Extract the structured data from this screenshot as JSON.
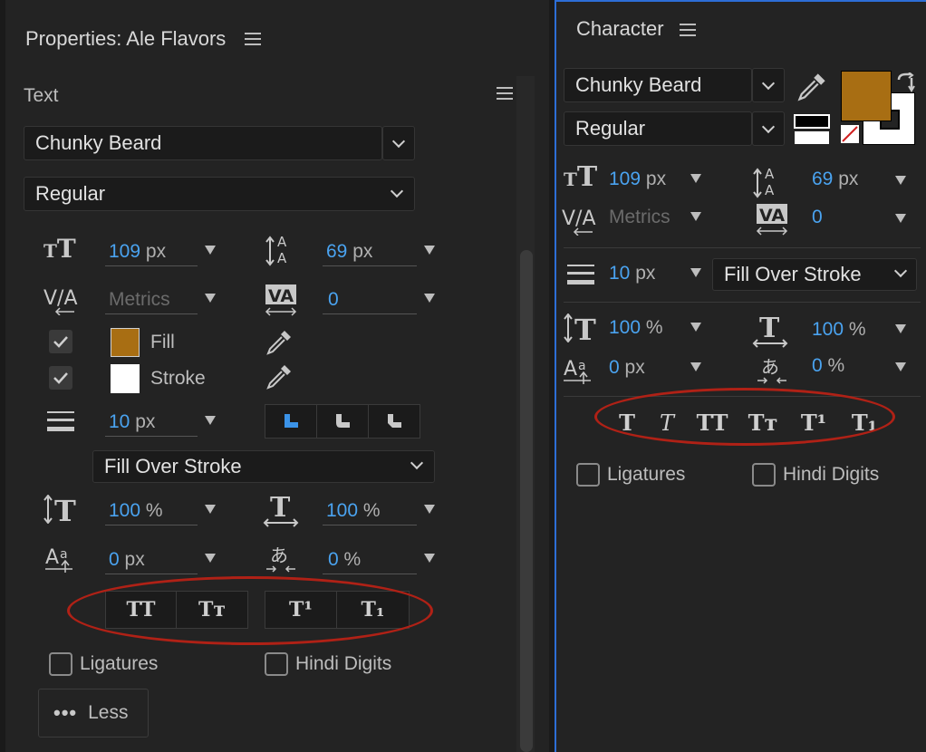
{
  "left_panel": {
    "title": "Properties: Ale Flavors",
    "section": "Text",
    "font_family": "Chunky Beard",
    "font_style": "Regular",
    "font_size": {
      "value": "109",
      "unit": "px"
    },
    "leading": {
      "value": "69",
      "unit": "px"
    },
    "kerning": "Metrics",
    "tracking": "0",
    "fill_label": "Fill",
    "stroke_label": "Stroke",
    "stroke_width": {
      "value": "10",
      "unit": "px"
    },
    "stroke_mode": "Fill Over Stroke",
    "vertical_scale": {
      "value": "100",
      "unit": "%"
    },
    "horizontal_scale": {
      "value": "100",
      "unit": "%"
    },
    "baseline_shift": {
      "value": "0",
      "unit": "px"
    },
    "tsume": {
      "value": "0",
      "unit": "%"
    },
    "style_buttons": [
      "TT",
      "Tᴛ",
      "T¹",
      "T₁"
    ],
    "ligatures_label": "Ligatures",
    "hindi_digits_label": "Hindi Digits",
    "less_button": "Less",
    "fill_color": "#a86e13",
    "stroke_color": "#ffffff"
  },
  "right_panel": {
    "title": "Character",
    "font_family": "Chunky Beard",
    "font_style": "Regular",
    "font_size": {
      "value": "109",
      "unit": "px"
    },
    "leading": {
      "value": "69",
      "unit": "px"
    },
    "kerning": "Metrics",
    "tracking": "0",
    "stroke_width": {
      "value": "10",
      "unit": "px"
    },
    "stroke_mode": "Fill Over Stroke",
    "vertical_scale": {
      "value": "100",
      "unit": "%"
    },
    "horizontal_scale": {
      "value": "100",
      "unit": "%"
    },
    "baseline_shift": {
      "value": "0",
      "unit": "px"
    },
    "tsume": {
      "value": "0",
      "unit": "%"
    },
    "style_buttons": [
      "T",
      "T",
      "TT",
      "Tᴛ",
      "T¹",
      "T₁"
    ],
    "ligatures_label": "Ligatures",
    "hindi_digits_label": "Hindi Digits",
    "fill_color": "#a86e13"
  },
  "icons": [
    "menu-icon",
    "chevron-down-icon",
    "font-size-icon",
    "leading-icon",
    "kerning-icon",
    "tracking-icon",
    "eyedropper-icon",
    "checkbox-checked-icon",
    "stroke-lines-icon",
    "corner-miter-icon",
    "corner-round-icon",
    "corner-bevel-icon",
    "vertical-scale-icon",
    "horizontal-scale-icon",
    "baseline-shift-icon",
    "tsume-icon",
    "swap-icon",
    "ellipsis-icon"
  ],
  "highlight_color": "#b02116",
  "accent_value_color": "#4aa3f0"
}
